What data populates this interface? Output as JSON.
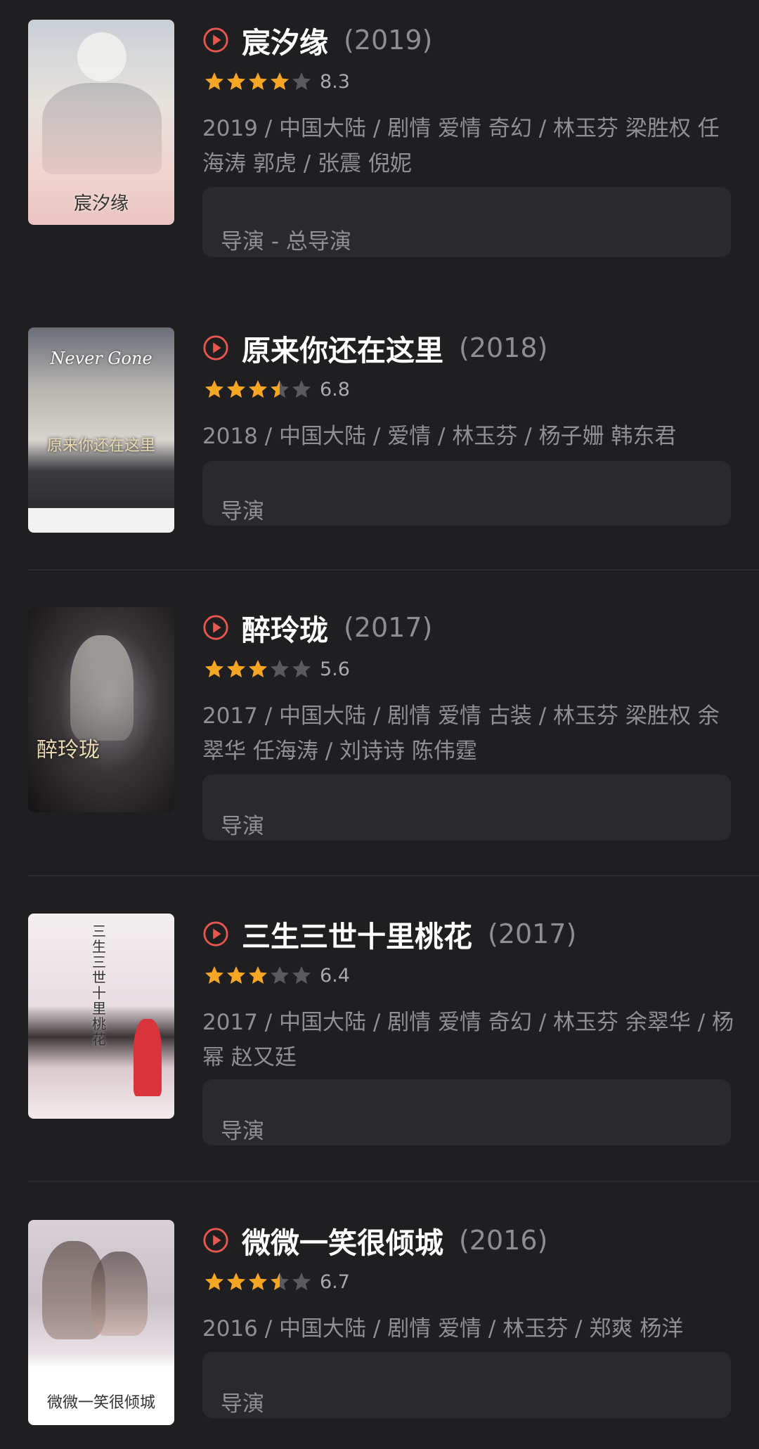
{
  "items": [
    {
      "title": "宸汐缘",
      "year": "(2019)",
      "stars": [
        1,
        1,
        1,
        1,
        0
      ],
      "score": "8.3",
      "meta": "2019 / 中国大陆 / 剧情 爱情 奇幻 / 林玉芬 梁胜权 任海涛 郭虎 / 张震 倪妮",
      "credit": "导演 - 总导演",
      "poster_caption": "宸汐缘"
    },
    {
      "title": "原来你还在这里",
      "year": "(2018)",
      "stars": [
        1,
        1,
        1,
        0.5,
        0
      ],
      "score": "6.8",
      "meta": "2018 / 中国大陆 / 爱情 / 林玉芬 / 杨子姗 韩东君",
      "credit": "导演",
      "poster_caption": "原来你还在这里",
      "poster_sub": "Never Gone"
    },
    {
      "title": "醉玲珑",
      "year": "(2017)",
      "stars": [
        1,
        1,
        1,
        0,
        0
      ],
      "score": "5.6",
      "meta": "2017 / 中国大陆 / 剧情 爱情 古装 / 林玉芬 梁胜权 余翠华 任海涛 / 刘诗诗 陈伟霆",
      "credit": "导演",
      "poster_caption": "醉玲珑"
    },
    {
      "title": "三生三世十里桃花",
      "year": "(2017)",
      "stars": [
        1,
        1,
        1,
        0,
        0
      ],
      "score": "6.4",
      "meta": "2017 / 中国大陆 / 剧情 爱情 奇幻 / 林玉芬 余翠华 / 杨幂 赵又廷",
      "credit": "导演",
      "poster_caption": "三生三世十里桃花"
    },
    {
      "title": "微微一笑很倾城",
      "year": "(2016)",
      "stars": [
        1,
        1,
        1,
        0.5,
        0
      ],
      "score": "6.7",
      "meta": "2016 / 中国大陆 / 剧情 爱情 / 林玉芬 / 郑爽 杨洋",
      "credit": "导演",
      "poster_caption": "微微一笑很倾城"
    }
  ],
  "colors": {
    "background": "#1f1f21",
    "accent": "#e8574f",
    "star_filled": "#f5a623",
    "star_empty": "#5a5a5e",
    "card": "#2a2a2d"
  },
  "icons": {
    "play": "play-circle-icon",
    "star": "star-icon"
  }
}
